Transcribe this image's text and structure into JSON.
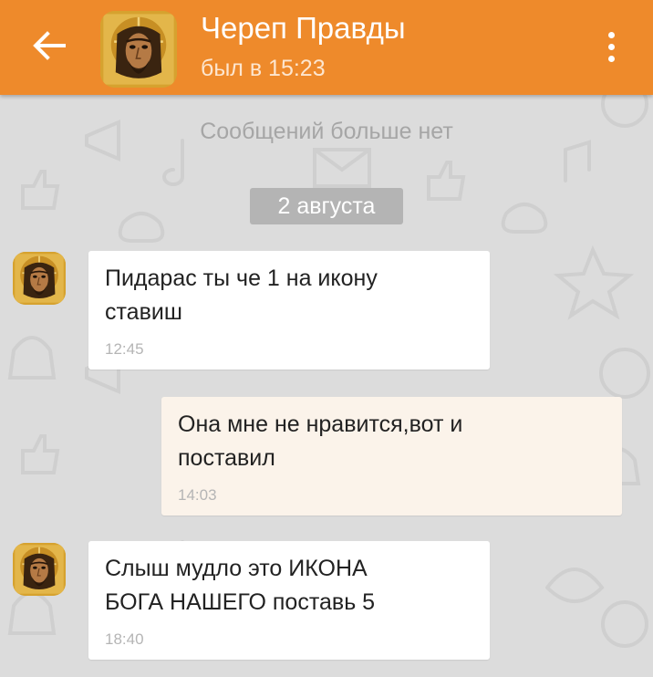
{
  "header": {
    "contact_name": "Череп Правды",
    "last_seen": "был в 15:23",
    "back_icon": "arrow-left-icon",
    "menu_icon": "more-vertical-icon",
    "accent_color": "#ee8a2b"
  },
  "chat": {
    "no_more_messages": "Сообщений больше нет",
    "date_divider": "2 августа",
    "messages": [
      {
        "direction": "incoming",
        "line1": "Пидарас ты че 1 на икону",
        "line2": "ставиш",
        "time": "12:45"
      },
      {
        "direction": "outgoing",
        "line1": "Она мне не нравится,вот и",
        "line2": "поставил",
        "time": "14:03"
      },
      {
        "direction": "incoming",
        "line1": "Слыш мудло это ИКОНА",
        "line2": "БОГА НАШЕГО поставь 5",
        "time": "18:40"
      }
    ]
  }
}
